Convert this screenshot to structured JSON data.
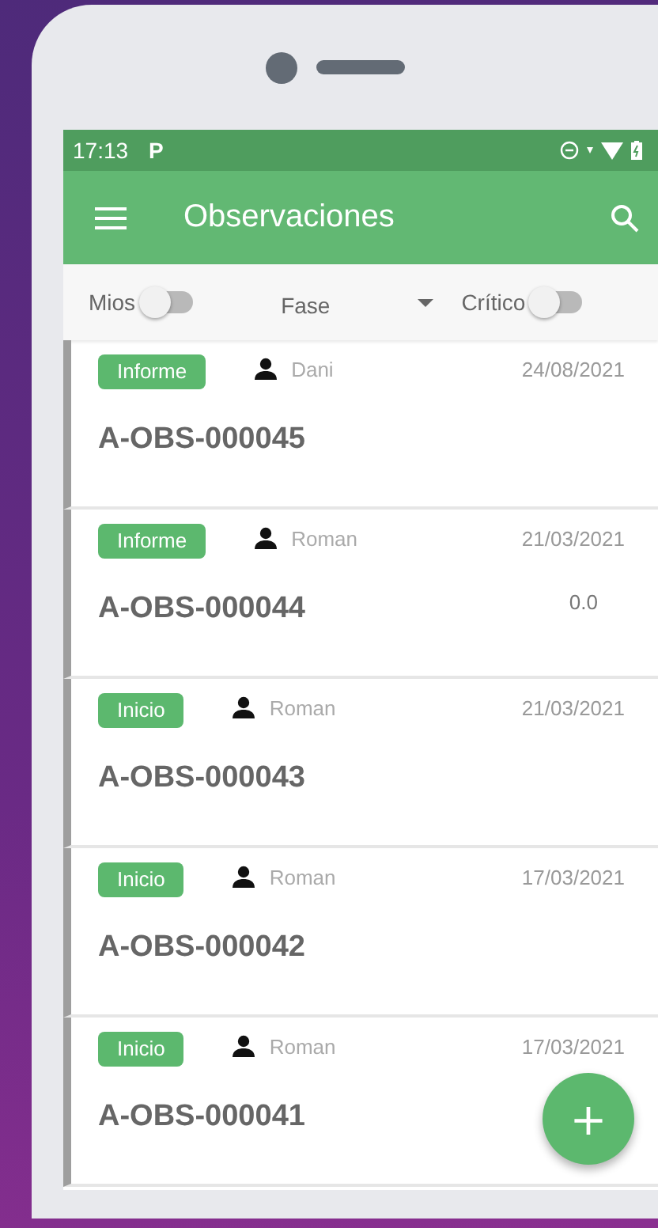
{
  "status_bar": {
    "time": "17:13",
    "notification_glyph": "P"
  },
  "app_bar": {
    "title": "Observaciones"
  },
  "filters": {
    "mine": {
      "label": "Mios",
      "on": false
    },
    "phase": {
      "label": "Fase"
    },
    "critical": {
      "label": "Crítico",
      "on": false
    }
  },
  "observations": [
    {
      "phase": "Informe",
      "user": "Dani",
      "date": "24/08/2021",
      "code": "A-OBS-000045"
    },
    {
      "phase": "Informe",
      "user": "Roman",
      "date": "21/03/2021",
      "code": "A-OBS-000044",
      "value": "0.0"
    },
    {
      "phase": "Inicio",
      "user": "Roman",
      "date": "21/03/2021",
      "code": "A-OBS-000043"
    },
    {
      "phase": "Inicio",
      "user": "Roman",
      "date": "17/03/2021",
      "code": "A-OBS-000042"
    },
    {
      "phase": "Inicio",
      "user": "Roman",
      "date": "17/03/2021",
      "code": "A-OBS-000041"
    }
  ],
  "fab": {
    "label": "+"
  }
}
